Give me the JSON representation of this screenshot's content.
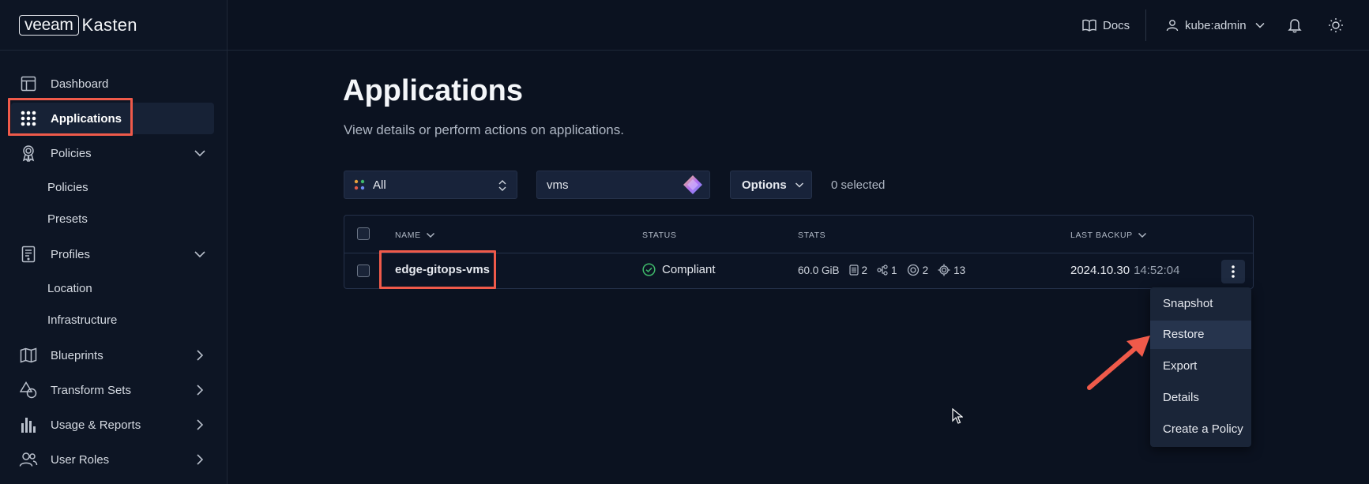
{
  "brand": {
    "logo_box": "veeam",
    "logo_text": "Kasten"
  },
  "topbar": {
    "docs_label": "Docs",
    "user_label": "kube:admin"
  },
  "sidebar": {
    "items": [
      {
        "label": "Dashboard",
        "icon": "dashboard-icon"
      },
      {
        "label": "Applications",
        "icon": "grid-dots-icon",
        "active": true
      },
      {
        "label": "Policies",
        "icon": "ribbon-icon",
        "expanded": true,
        "children": [
          "Policies",
          "Presets"
        ]
      },
      {
        "label": "Profiles",
        "icon": "profile-doc-icon",
        "expanded": true,
        "children": [
          "Location",
          "Infrastructure"
        ]
      },
      {
        "label": "Blueprints",
        "icon": "map-icon"
      },
      {
        "label": "Transform Sets",
        "icon": "shapes-icon"
      },
      {
        "label": "Usage & Reports",
        "icon": "bar-chart-icon"
      },
      {
        "label": "User Roles",
        "icon": "users-icon"
      }
    ]
  },
  "main": {
    "title": "Applications",
    "subtitle": "View details or perform actions on applications.",
    "filter": {
      "value": "All"
    },
    "search": {
      "value": "vms"
    },
    "options_label": "Options",
    "selected_count": "0 selected",
    "table": {
      "columns": [
        "NAME",
        "STATUS",
        "STATS",
        "LAST BACKUP"
      ],
      "rows": [
        {
          "name": "edge-gitops-vms",
          "status": "Compliant",
          "size": "60.0 GiB",
          "stat_volumes": "2",
          "stat_services": "1",
          "stat_workloads": "2",
          "stat_resources": "13",
          "last_backup_date": "2024.10.30",
          "last_backup_time": "14:52:04"
        }
      ]
    },
    "action_menu": [
      "Snapshot",
      "Restore",
      "Export",
      "Details",
      "Create a Policy"
    ]
  },
  "colors": {
    "background": "#0b1220",
    "highlight": "#ef5a4a",
    "compliant": "#3fb96a"
  }
}
